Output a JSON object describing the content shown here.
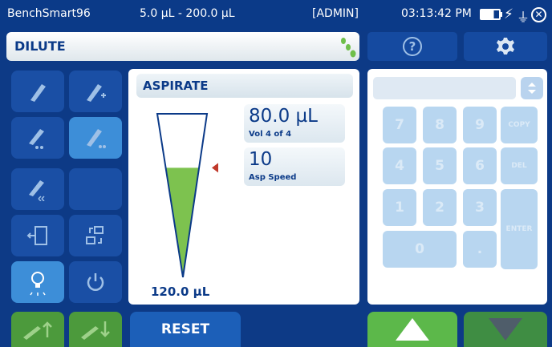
{
  "status": {
    "device": "BenchSmart96",
    "range": "5.0 µL - 200.0 µL",
    "user": "[ADMIN]",
    "time": "03:13:42 PM"
  },
  "mode": {
    "title": "DILUTE"
  },
  "aspirate": {
    "header": "ASPIRATE",
    "volume": "80.0 µL",
    "volume_sub": "Vol 4 of 4",
    "speed": "10",
    "speed_sub": "Asp Speed",
    "total": "120.0 µL",
    "fill_fraction": 0.67
  },
  "keypad": {
    "keys": [
      "7",
      "8",
      "9",
      "COPY",
      "4",
      "5",
      "6",
      "DEL",
      "1",
      "2",
      "3",
      "ENTER",
      "0",
      "."
    ]
  },
  "buttons": {
    "reset": "RESET"
  },
  "colors": {
    "bg": "#0d3a86",
    "accent_green": "#5cb84a",
    "liquid": "#7dc24f",
    "marker": "#c0392b"
  }
}
